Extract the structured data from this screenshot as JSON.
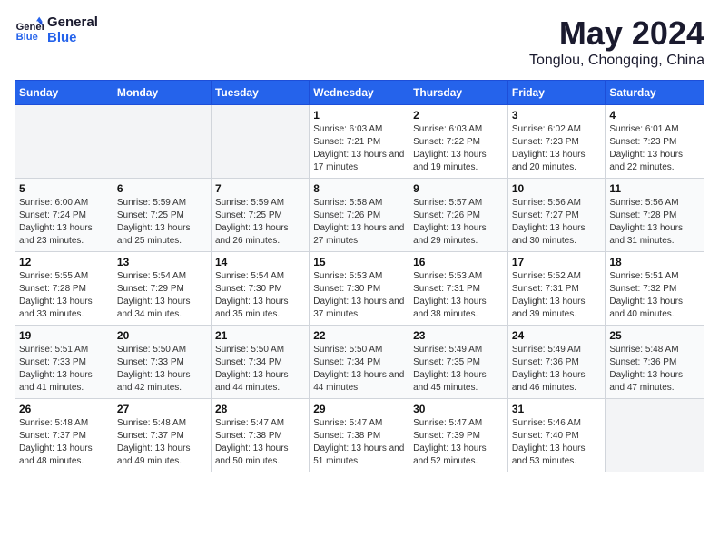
{
  "logo": {
    "text_general": "General",
    "text_blue": "Blue"
  },
  "header": {
    "title": "May 2024",
    "subtitle": "Tonglou, Chongqing, China"
  },
  "weekdays": [
    "Sunday",
    "Monday",
    "Tuesday",
    "Wednesday",
    "Thursday",
    "Friday",
    "Saturday"
  ],
  "weeks": [
    [
      {
        "day": "",
        "empty": true
      },
      {
        "day": "",
        "empty": true
      },
      {
        "day": "",
        "empty": true
      },
      {
        "day": "1",
        "sunrise": "6:03 AM",
        "sunset": "7:21 PM",
        "daylight": "13 hours and 17 minutes."
      },
      {
        "day": "2",
        "sunrise": "6:03 AM",
        "sunset": "7:22 PM",
        "daylight": "13 hours and 19 minutes."
      },
      {
        "day": "3",
        "sunrise": "6:02 AM",
        "sunset": "7:23 PM",
        "daylight": "13 hours and 20 minutes."
      },
      {
        "day": "4",
        "sunrise": "6:01 AM",
        "sunset": "7:23 PM",
        "daylight": "13 hours and 22 minutes."
      }
    ],
    [
      {
        "day": "5",
        "sunrise": "6:00 AM",
        "sunset": "7:24 PM",
        "daylight": "13 hours and 23 minutes."
      },
      {
        "day": "6",
        "sunrise": "5:59 AM",
        "sunset": "7:25 PM",
        "daylight": "13 hours and 25 minutes."
      },
      {
        "day": "7",
        "sunrise": "5:59 AM",
        "sunset": "7:25 PM",
        "daylight": "13 hours and 26 minutes."
      },
      {
        "day": "8",
        "sunrise": "5:58 AM",
        "sunset": "7:26 PM",
        "daylight": "13 hours and 27 minutes."
      },
      {
        "day": "9",
        "sunrise": "5:57 AM",
        "sunset": "7:26 PM",
        "daylight": "13 hours and 29 minutes."
      },
      {
        "day": "10",
        "sunrise": "5:56 AM",
        "sunset": "7:27 PM",
        "daylight": "13 hours and 30 minutes."
      },
      {
        "day": "11",
        "sunrise": "5:56 AM",
        "sunset": "7:28 PM",
        "daylight": "13 hours and 31 minutes."
      }
    ],
    [
      {
        "day": "12",
        "sunrise": "5:55 AM",
        "sunset": "7:28 PM",
        "daylight": "13 hours and 33 minutes."
      },
      {
        "day": "13",
        "sunrise": "5:54 AM",
        "sunset": "7:29 PM",
        "daylight": "13 hours and 34 minutes."
      },
      {
        "day": "14",
        "sunrise": "5:54 AM",
        "sunset": "7:30 PM",
        "daylight": "13 hours and 35 minutes."
      },
      {
        "day": "15",
        "sunrise": "5:53 AM",
        "sunset": "7:30 PM",
        "daylight": "13 hours and 37 minutes."
      },
      {
        "day": "16",
        "sunrise": "5:53 AM",
        "sunset": "7:31 PM",
        "daylight": "13 hours and 38 minutes."
      },
      {
        "day": "17",
        "sunrise": "5:52 AM",
        "sunset": "7:31 PM",
        "daylight": "13 hours and 39 minutes."
      },
      {
        "day": "18",
        "sunrise": "5:51 AM",
        "sunset": "7:32 PM",
        "daylight": "13 hours and 40 minutes."
      }
    ],
    [
      {
        "day": "19",
        "sunrise": "5:51 AM",
        "sunset": "7:33 PM",
        "daylight": "13 hours and 41 minutes."
      },
      {
        "day": "20",
        "sunrise": "5:50 AM",
        "sunset": "7:33 PM",
        "daylight": "13 hours and 42 minutes."
      },
      {
        "day": "21",
        "sunrise": "5:50 AM",
        "sunset": "7:34 PM",
        "daylight": "13 hours and 44 minutes."
      },
      {
        "day": "22",
        "sunrise": "5:50 AM",
        "sunset": "7:34 PM",
        "daylight": "13 hours and 44 minutes."
      },
      {
        "day": "23",
        "sunrise": "5:49 AM",
        "sunset": "7:35 PM",
        "daylight": "13 hours and 45 minutes."
      },
      {
        "day": "24",
        "sunrise": "5:49 AM",
        "sunset": "7:36 PM",
        "daylight": "13 hours and 46 minutes."
      },
      {
        "day": "25",
        "sunrise": "5:48 AM",
        "sunset": "7:36 PM",
        "daylight": "13 hours and 47 minutes."
      }
    ],
    [
      {
        "day": "26",
        "sunrise": "5:48 AM",
        "sunset": "7:37 PM",
        "daylight": "13 hours and 48 minutes."
      },
      {
        "day": "27",
        "sunrise": "5:48 AM",
        "sunset": "7:37 PM",
        "daylight": "13 hours and 49 minutes."
      },
      {
        "day": "28",
        "sunrise": "5:47 AM",
        "sunset": "7:38 PM",
        "daylight": "13 hours and 50 minutes."
      },
      {
        "day": "29",
        "sunrise": "5:47 AM",
        "sunset": "7:38 PM",
        "daylight": "13 hours and 51 minutes."
      },
      {
        "day": "30",
        "sunrise": "5:47 AM",
        "sunset": "7:39 PM",
        "daylight": "13 hours and 52 minutes."
      },
      {
        "day": "31",
        "sunrise": "5:46 AM",
        "sunset": "7:40 PM",
        "daylight": "13 hours and 53 minutes."
      },
      {
        "day": "",
        "empty": true
      }
    ]
  ]
}
